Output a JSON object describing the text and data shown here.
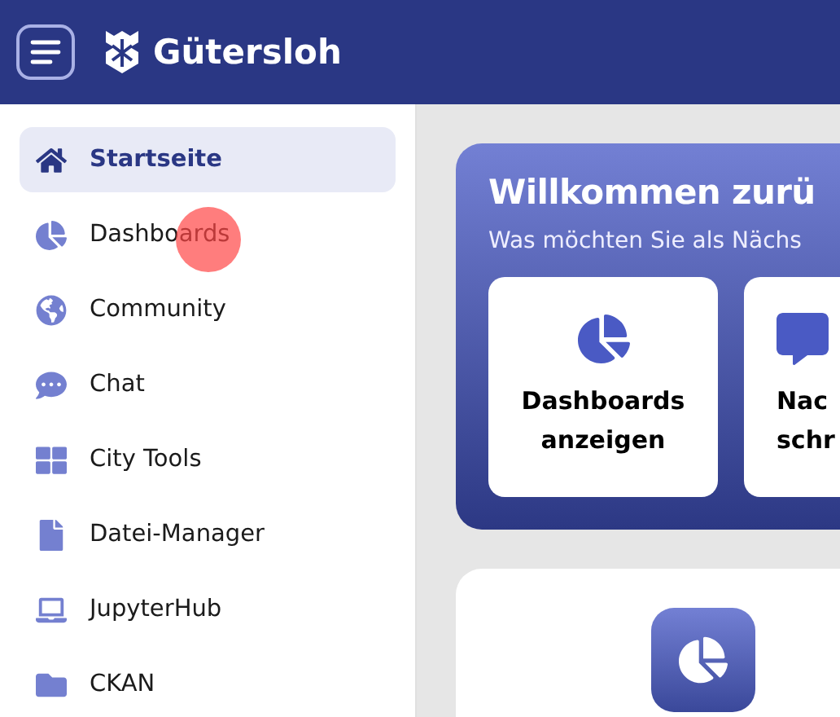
{
  "header": {
    "brand": "Gütersloh"
  },
  "sidebar": {
    "items": [
      {
        "label": "Startseite",
        "selected": true
      },
      {
        "label": "Dashboards",
        "selected": false
      },
      {
        "label": "Community",
        "selected": false
      },
      {
        "label": "Chat",
        "selected": false
      },
      {
        "label": "City Tools",
        "selected": false
      },
      {
        "label": "Datei-Manager",
        "selected": false
      },
      {
        "label": "JupyterHub",
        "selected": false
      },
      {
        "label": "CKAN",
        "selected": false
      }
    ]
  },
  "welcome": {
    "title": "Willkommen zurü",
    "subtitle": "Was möchten Sie als Nächs",
    "actions": [
      {
        "label": "Dashboards\nanzeigen",
        "kind": "full"
      },
      {
        "label": "Nac\nschr",
        "kind": "partial"
      }
    ]
  }
}
